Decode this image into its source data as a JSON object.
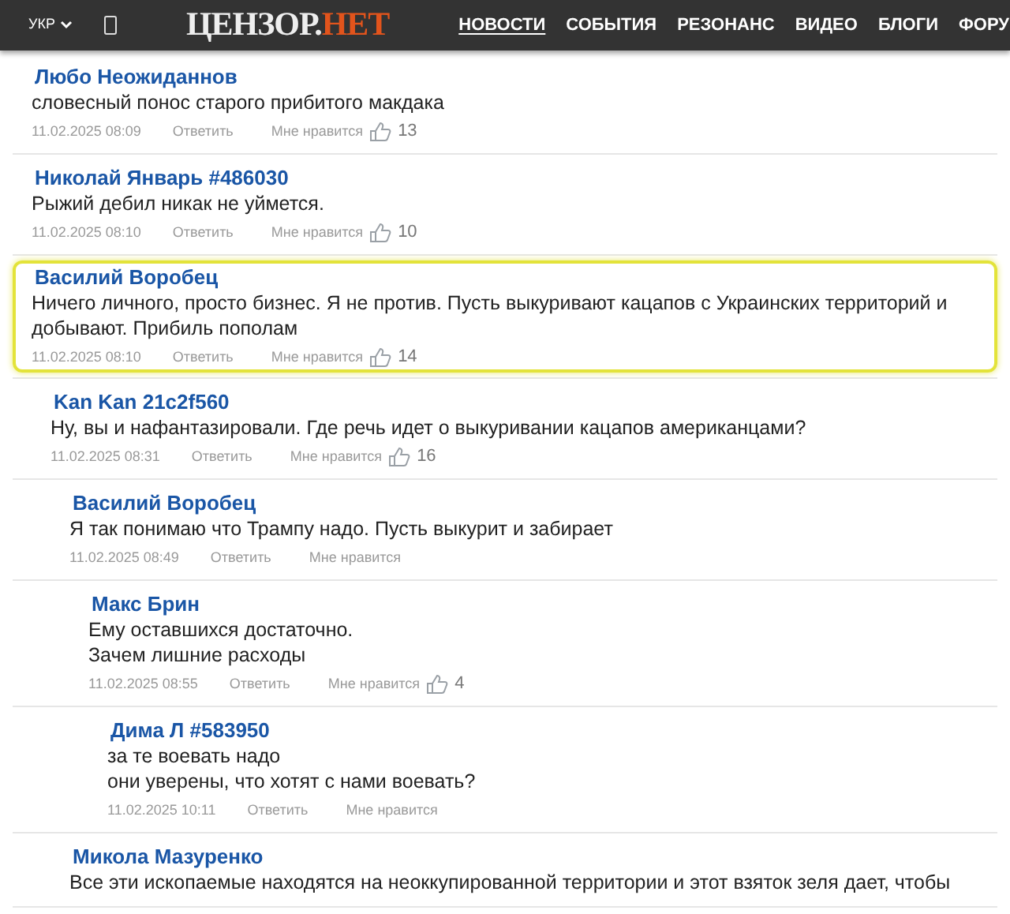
{
  "header": {
    "language": "УКР",
    "logo": {
      "main": "ЦЕНЗОР.",
      "accent": "НЕТ"
    },
    "nav": [
      {
        "label": "НОВОСТИ",
        "selected": true
      },
      {
        "label": "СОБЫТИЯ",
        "selected": false
      },
      {
        "label": "РЕЗОНАНС",
        "selected": false
      },
      {
        "label": "ВИДЕО",
        "selected": false
      },
      {
        "label": "БЛОГИ",
        "selected": false
      },
      {
        "label": "ФОРУ",
        "selected": false
      }
    ]
  },
  "comments": [
    {
      "author": "Любо Неожиданнов",
      "text": [
        "словесный понос старого прибитого макдака"
      ],
      "time": "11.02.2025 08:09",
      "reply": "Ответить",
      "like": "Мне нравится",
      "likes": "13",
      "highlighted": false
    },
    {
      "author": "Николай Январь #486030",
      "text": [
        "Рыжий дебил никак не уймется."
      ],
      "time": "11.02.2025 08:10",
      "reply": "Ответить",
      "like": "Мне нравится",
      "likes": "10",
      "highlighted": false
    },
    {
      "author": "Василий Воробец",
      "text": [
        "Ничего личного, просто бизнес. Я не против. Пусть выкуривают кацапов с Украинских территорий и добывают. Прибиль пополам"
      ],
      "time": "11.02.2025 08:10",
      "reply": "Ответить",
      "like": "Мне нравится",
      "likes": "14",
      "highlighted": true,
      "children": [
        {
          "author": "Kan Kan 21c2f560",
          "text": [
            "Ну, вы и нафантазировали. Где речь идет о выкуривании кацапов американцами?"
          ],
          "time": "11.02.2025 08:31",
          "reply": "Ответить",
          "like": "Мне нравится",
          "likes": "16",
          "highlighted": false,
          "children": [
            {
              "author": "Василий Воробец",
              "text": [
                "Я так понимаю что Трампу надо. Пусть выкурит и забирает"
              ],
              "time": "11.02.2025 08:49",
              "reply": "Ответить",
              "like": "Мне нравится",
              "highlighted": false,
              "children": [
                {
                  "author": "Макс Брин",
                  "text": [
                    "Ему оставшихся достаточно.",
                    "Зачем лишние расходы"
                  ],
                  "time": "11.02.2025 08:55",
                  "reply": "Ответить",
                  "like": "Мне нравится",
                  "likes": "4",
                  "highlighted": false,
                  "children": [
                    {
                      "author": "Дима Л #583950",
                      "text": [
                        "за те воевать надо",
                        "они уверены, что хотят с нами воевать?"
                      ],
                      "time": "11.02.2025 10:11",
                      "reply": "Ответить",
                      "like": "Мне нравится",
                      "highlighted": false
                    }
                  ]
                }
              ]
            },
            {
              "author": "Микола Мазуренко",
              "text": [
                "Все эти ископаемые находятся на неоккупированной территории и этот взяток зеля дает, чтобы"
              ],
              "highlighted": false
            }
          ]
        }
      ]
    }
  ]
}
